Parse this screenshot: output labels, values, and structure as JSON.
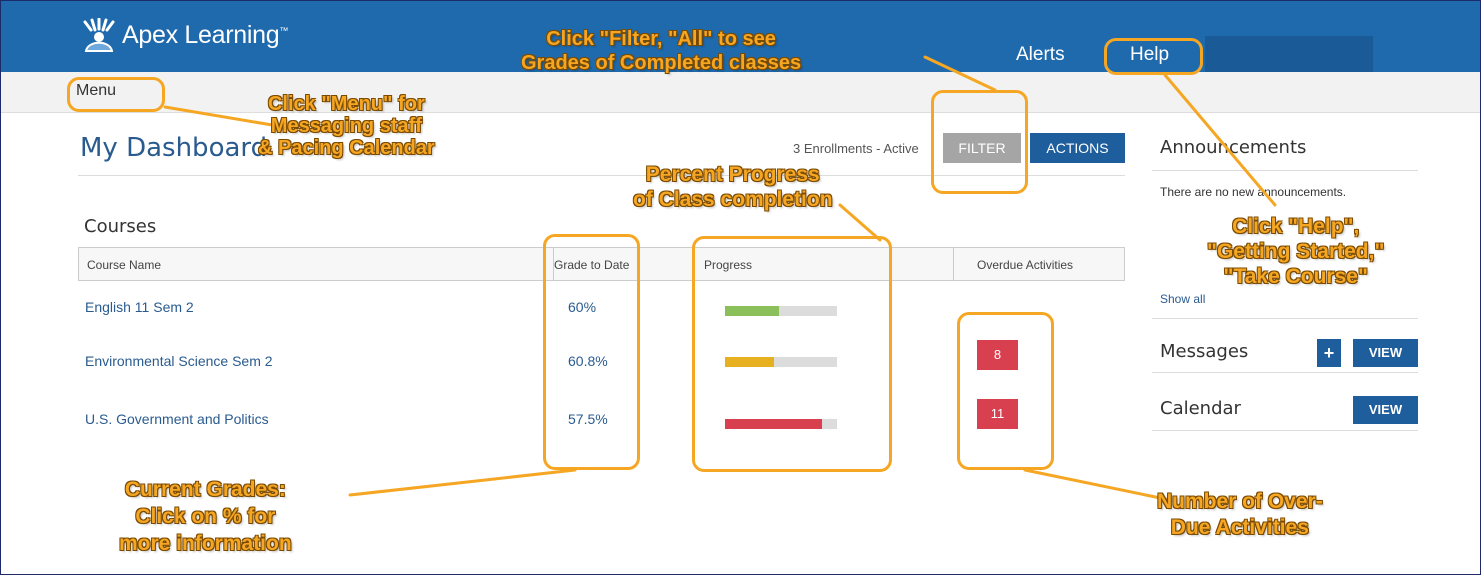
{
  "header": {
    "logo_text": "Apex Learning",
    "logo_mark": "™",
    "alerts_label": "Alerts",
    "help_label": "Help"
  },
  "menubar": {
    "menu_label": "Menu"
  },
  "dashboard": {
    "title": "My Dashboard",
    "enrollment_status": "3 Enrollments - Active",
    "filter_label": "FILTER",
    "actions_label": "ACTIONS"
  },
  "courses": {
    "heading": "Courses",
    "columns": [
      "Course Name",
      "Grade to Date",
      "Progress",
      "Overdue Activities"
    ],
    "rows": [
      {
        "name": "English 11 Sem 2",
        "grade": "60%",
        "progress": 0.48,
        "progress_color": "#8bbf5a",
        "overdue": ""
      },
      {
        "name": "Environmental Science Sem 2",
        "grade": "60.8%",
        "progress": 0.44,
        "progress_color": "#e6b021",
        "overdue": "8"
      },
      {
        "name": "U.S. Government and Politics",
        "grade": "57.5%",
        "progress": 0.87,
        "progress_color": "#d9404f",
        "overdue": "11"
      }
    ]
  },
  "sidebar": {
    "announcements_title": "Announcements",
    "announcements_message": "There are no new announcements.",
    "show_all_label": "Show all",
    "messages_title": "Messages",
    "calendar_title": "Calendar",
    "view_label": "VIEW",
    "add_label": "+"
  },
  "annotations": {
    "filter": [
      "Click \"Filter, \"All\" to see",
      "Grades of Completed classes"
    ],
    "menu": [
      "Click \"Menu\" for",
      "Messaging staff",
      "& Pacing Calendar"
    ],
    "progress": [
      "Percent Progress",
      "of Class completion"
    ],
    "help": [
      "Click \"Help\",",
      "\"Getting Started,\"",
      "\"Take Course\""
    ],
    "grades": [
      "Current Grades:",
      "Click on % for",
      "more information"
    ],
    "overdue": [
      "Number of Over-",
      "Due Activities"
    ]
  },
  "colors": {
    "brand_blue": "#1f6aad",
    "button_blue": "#1f5e9c",
    "filter_gray": "#a5a5a5",
    "overdue_red": "#d9404f",
    "annotation_orange": "#f5a623"
  }
}
